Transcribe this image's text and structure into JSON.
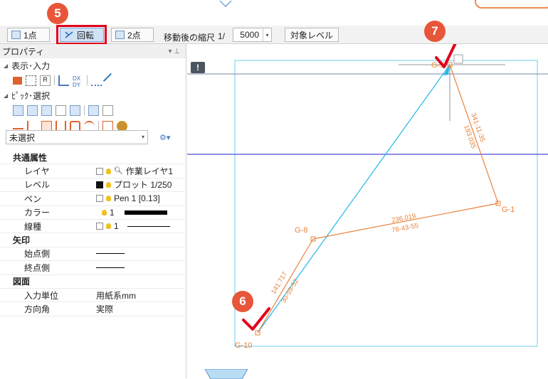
{
  "toolbar": {
    "btn_1pt": "1点",
    "btn_rotate": "回転",
    "btn_2pt": "2点",
    "scale_label": "移動後の縮尺",
    "scale_prefix": "1/",
    "scale_value": "5000",
    "target_level_button": "対象レベル"
  },
  "badges": {
    "b5": "5",
    "b6": "6",
    "b7": "7"
  },
  "panel": {
    "title": "プロパティ",
    "pin": "▾ ⊥",
    "section_display": "表示･入力",
    "section_pick": "ﾋﾟｯｸ･選択",
    "selection_value": "未選択"
  },
  "properties": {
    "group_common": "共通属性",
    "layer_label": "レイヤ",
    "layer_value": "作業レイヤ1",
    "level_label": "レベル",
    "level_value": "プロット 1/250",
    "pen_label": "ペン",
    "pen_value": "Pen 1 [0.13]",
    "color_label": "カラー",
    "color_value": "1",
    "linetype_label": "線種",
    "linetype_value": "1",
    "group_arrow": "矢印",
    "start_label": "始点側",
    "end_label": "終点側",
    "group_drawing": "図面",
    "input_unit_label": "入力単位",
    "input_unit_value": "用紙系mm",
    "direction_label": "方向角",
    "direction_value": "実際"
  },
  "drawing": {
    "points": {
      "g1": "G-1",
      "g5": "G-5",
      "g8": "G-8",
      "g10": "G-10"
    },
    "dims": {
      "g5_g1_a": "341-11-35",
      "g5_g1_b": "183.035",
      "g8_g1_a": "236.019",
      "g8_g1_b": "78-43-55",
      "g10_g8_a": "141.717",
      "g10_g8_b": "30-59-52"
    },
    "warning_icon": "!"
  },
  "colors": {
    "accent_red": "#e0001b",
    "badge": "#e8563a",
    "orange_line": "#e8823c",
    "cyan_line": "#23b6e6",
    "blue_line": "#4a4ad6",
    "frame": "#6ad0ee"
  }
}
